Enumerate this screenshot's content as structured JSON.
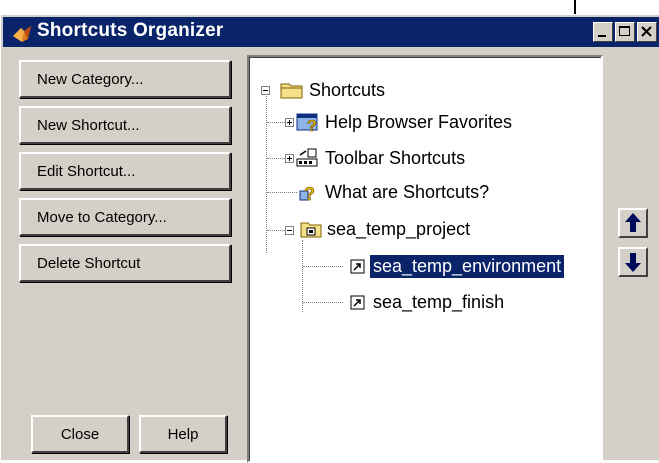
{
  "window": {
    "title": "Shortcuts Organizer"
  },
  "buttons": {
    "new_category": "New Category...",
    "new_shortcut": "New Shortcut...",
    "edit_shortcut": "Edit Shortcut...",
    "move_to_category": "Move to Category...",
    "delete_shortcut": "Delete Shortcut",
    "close": "Close",
    "help": "Help"
  },
  "tree": {
    "root": "Shortcuts",
    "items": [
      {
        "label": "Help Browser Favorites"
      },
      {
        "label": "Toolbar Shortcuts"
      },
      {
        "label": "What are Shortcuts?"
      },
      {
        "label": "sea_temp_project"
      },
      {
        "label": "sea_temp_environment"
      },
      {
        "label": "sea_temp_finish"
      }
    ]
  },
  "colors": {
    "titlebar": "#0a246a",
    "selection": "#0a246a",
    "face": "#d4d0c8"
  },
  "icons": {
    "app": "matlab-icon",
    "move_up": "arrow-up-icon",
    "move_down": "arrow-down-icon"
  }
}
